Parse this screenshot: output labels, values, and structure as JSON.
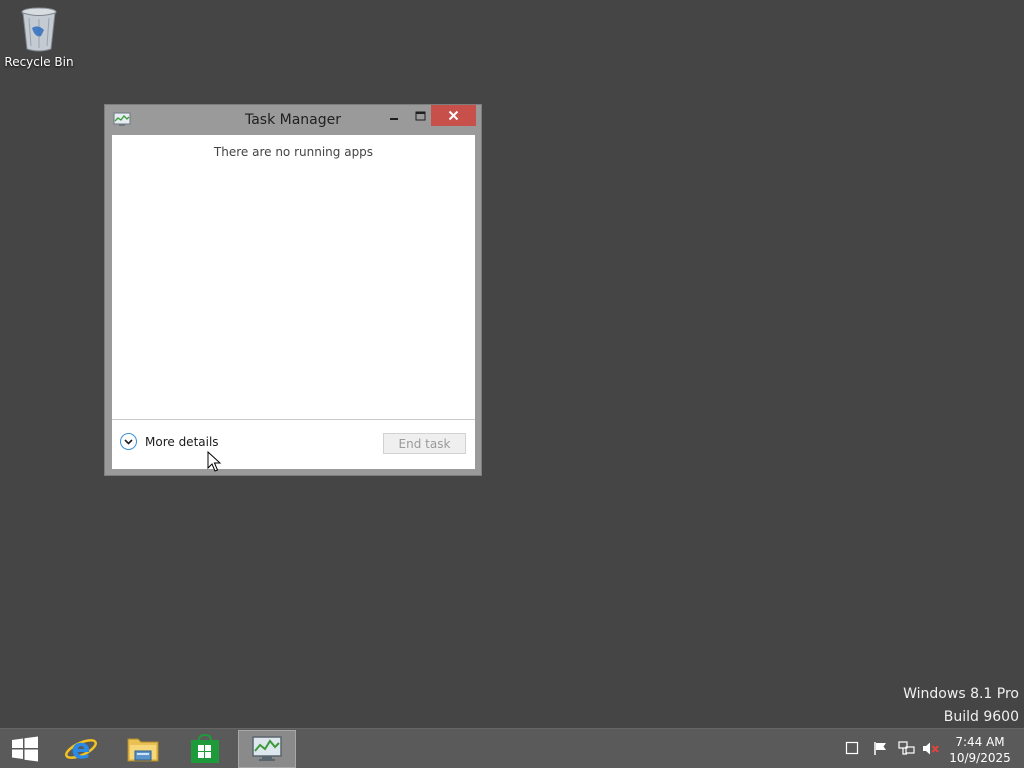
{
  "desktop": {
    "icons": [
      {
        "label": "Recycle Bin",
        "icon": "recycle-bin-icon"
      }
    ]
  },
  "task_manager": {
    "title": "Task Manager",
    "empty_message": "There are no running apps",
    "more_details_label": "More details",
    "end_task_label": "End task",
    "end_task_enabled": false
  },
  "watermark": {
    "edition": "Windows 8.1 Pro",
    "build": "Build 9600"
  },
  "taskbar": {
    "items": [
      {
        "name": "start",
        "icon": "windows-logo-icon"
      },
      {
        "name": "internet-explorer",
        "icon": "internet-explorer-icon"
      },
      {
        "name": "file-explorer",
        "icon": "folder-icon"
      },
      {
        "name": "store",
        "icon": "store-icon"
      },
      {
        "name": "task-manager",
        "icon": "task-manager-icon",
        "active": true
      }
    ],
    "tray": {
      "icons": [
        "notification-box-icon",
        "action-center-flag-icon",
        "network-icon",
        "volume-muted-icon"
      ],
      "time": "7:44 AM",
      "date": "10/9/2025"
    }
  },
  "colors": {
    "desktop_bg": "#454545",
    "window_frame": "#9a9a9a",
    "close_button": "#c7504b",
    "taskbar_bg": "#5a5a5a",
    "accent_blue": "#3c8fd8"
  }
}
